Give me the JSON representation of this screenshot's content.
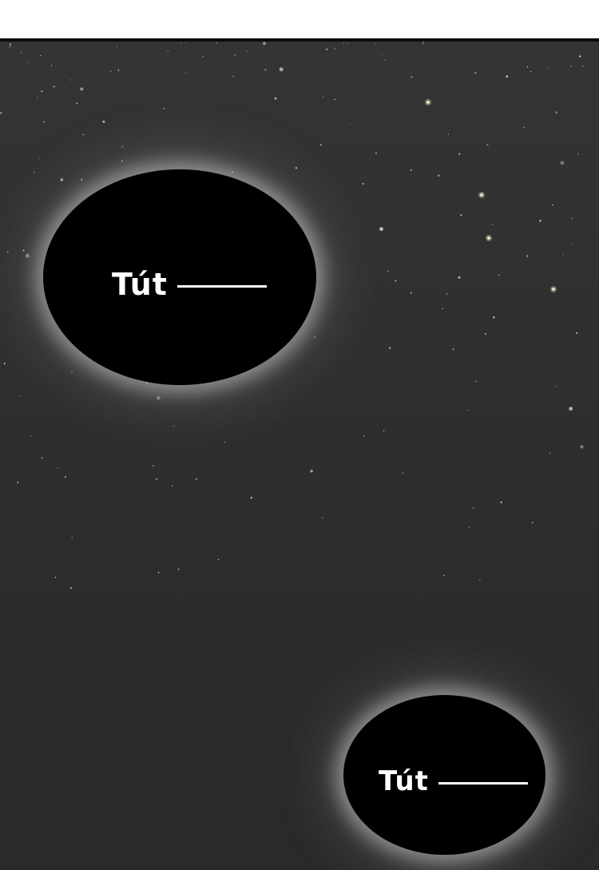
{
  "page": {
    "background_color": "#ffffff",
    "panel_color": "#303030",
    "panel_border_color": "#0c0c0c"
  },
  "bubbles": [
    {
      "sfx_text": "Tút"
    },
    {
      "sfx_text": "Tút"
    }
  ],
  "colors": {
    "bubble_fill": "#000000",
    "bubble_glow": "#c8c8c8",
    "text": "#ffffff",
    "star": "#e6e0c8"
  }
}
